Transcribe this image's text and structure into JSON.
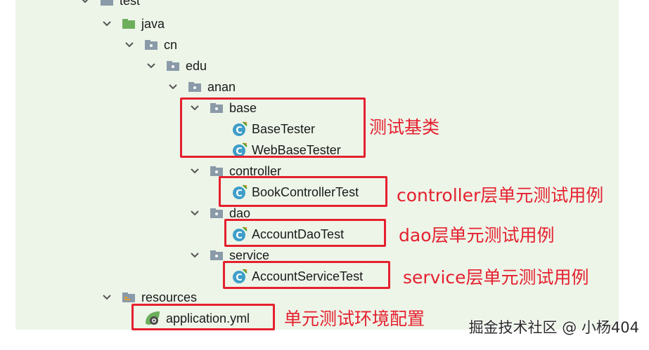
{
  "tree": {
    "test": "test",
    "java": "java",
    "cn": "cn",
    "edu": "edu",
    "anan": "anan",
    "base": "base",
    "base_tester": "BaseTester",
    "web_base_tester": "WebBaseTester",
    "controller": "controller",
    "book_controller_test": "BookControllerTest",
    "dao": "dao",
    "account_dao_test": "AccountDaoTest",
    "service": "service",
    "account_service_test": "AccountServiceTest",
    "resources": "resources",
    "application_yml": "application.yml"
  },
  "annotations": {
    "base": "测试基类",
    "controller": "controller层单元测试用例",
    "dao": "dao层单元测试用例",
    "service": "service层单元测试用例",
    "resources": "单元测试环境配置"
  },
  "watermark": "掘金技术社区 @ 小杨404",
  "colors": {
    "panel_bg": "#edf5e9",
    "highlight": "#e5202e",
    "folder": "#8a9aa8",
    "java_folder": "#6cae5b",
    "class_icon": "#3e9ec8"
  }
}
